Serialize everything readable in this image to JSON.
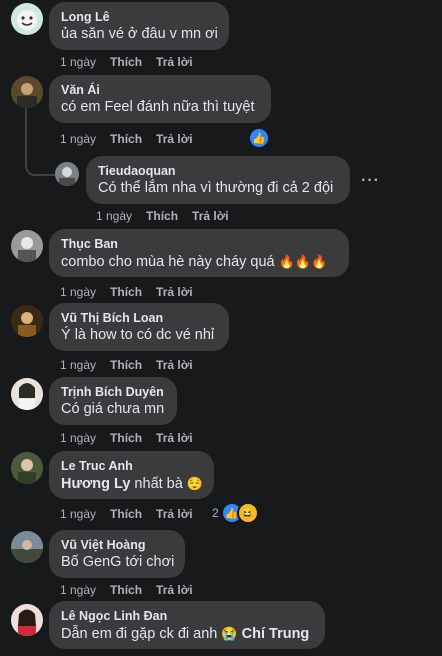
{
  "comments": [
    {
      "author": "Long Lê",
      "text": "ủa săn vé ở đâu v mn ơi",
      "time": "1 ngày",
      "like": "Thích",
      "reply": "Trả lời"
    },
    {
      "author": "Văn Ái",
      "text": "có em Feel đánh nữa thì tuyệt",
      "time": "1 ngày",
      "like": "Thích",
      "reply": "Trả lời"
    },
    {
      "author": "Tieudaoquan",
      "text": "Có thể lắm nha vì thường đi cả 2 đội",
      "time": "1 ngày",
      "like": "Thích",
      "reply": "Trả lời",
      "more": "···"
    },
    {
      "author": "Thục Ban",
      "text": "combo cho mùa hè này cháy quá",
      "emoji": "🔥🔥🔥",
      "time": "1 ngày",
      "like": "Thích",
      "reply": "Trả lời"
    },
    {
      "author": "Vũ Thị Bích Loan",
      "text": "Ý là how to có dc vé nhỉ",
      "time": "1 ngày",
      "like": "Thích",
      "reply": "Trả lời"
    },
    {
      "author": "Trịnh Bích Duyên",
      "text": "Có giá chưa mn",
      "time": "1 ngày",
      "like": "Thích",
      "reply": "Trả lời"
    },
    {
      "author": "Le Truc Anh",
      "mention": "Hương Ly",
      "text": " nhất bà",
      "emoji": "😌",
      "time": "1 ngày",
      "like": "Thích",
      "reply": "Trả lời",
      "reaction_count": "2"
    },
    {
      "author": "Vũ Việt Hoàng",
      "text": "Bố GenG tới chơi",
      "time": "1 ngày",
      "like": "Thích",
      "reply": "Trả lời"
    },
    {
      "author": "Lê Ngọc Linh Đan",
      "text": "Dẫn em đi gặp ck đi anh",
      "emoji": "😭",
      "mention": "Chí Trung"
    }
  ],
  "colors": {
    "background": "#18191a",
    "bubble": "#3a3b3c",
    "text": "#e4e6eb",
    "muted": "#b0b3b8",
    "like": "#2d88ff"
  }
}
